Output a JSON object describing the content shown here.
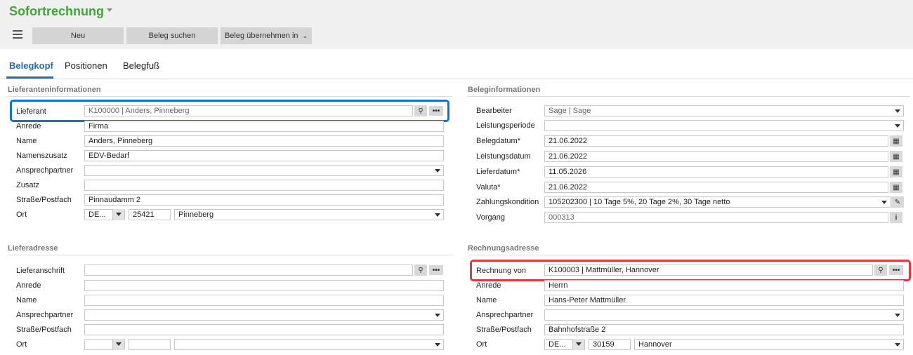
{
  "app": {
    "title": "Sofortrechnung"
  },
  "toolbar": {
    "new_label": "Neu",
    "search_label": "Beleg suchen",
    "adopt_label": "Beleg übernehmen in"
  },
  "tabs": [
    {
      "label": "Belegkopf"
    },
    {
      "label": "Positionen"
    },
    {
      "label": "Belegfuß"
    }
  ],
  "supplier": {
    "title": "Lieferanteninformationen",
    "lieferant_label": "Lieferant",
    "lieferant_value": "K100000  |  Anders, Pinneberg",
    "anrede_label": "Anrede",
    "anrede_value": "Firma",
    "name_label": "Name",
    "name_value": "Anders, Pinneberg",
    "zusatz_name_label": "Namenszusatz",
    "zusatz_name_value": "EDV-Bedarf",
    "ansprech_label": "Ansprechpartner",
    "ansprech_value": "",
    "zusatz_label": "Zusatz",
    "zusatz_value": "",
    "strasse_label": "Straße/Postfach",
    "strasse_value": "Pinnaudamm 2",
    "ort_label": "Ort",
    "country_value": "DE...",
    "plz_value": "25421",
    "city_value": "Pinneberg"
  },
  "doc_info": {
    "title": "Beleginformationen",
    "bearbeiter_label": "Bearbeiter",
    "bearbeiter_value": "Sage  |  Sage",
    "periode_label": "Leistungsperiode",
    "periode_value": "",
    "belegdatum_label": "Belegdatum*",
    "belegdatum_value": "21.06.2022",
    "leistungsdatum_label": "Leistungsdatum",
    "leistungsdatum_value": "21.06.2022",
    "lieferdatum_label": "Lieferdatum*",
    "lieferdatum_value": "11.05.2026",
    "valuta_label": "Valuta*",
    "valuta_value": "21.06.2022",
    "zahlung_label": "Zahlungskondition",
    "zahlung_value": "105202300  |  10 Tage 5%, 20 Tage 2%, 30 Tage netto",
    "vorgang_label": "Vorgang",
    "vorgang_value": "000313"
  },
  "delivery": {
    "title": "Lieferadresse",
    "anschrift_label": "Lieferanschrift",
    "anschrift_value": "",
    "anrede_label": "Anrede",
    "anrede_value": "",
    "name_label": "Name",
    "name_value": "",
    "ansprech_label": "Ansprechpartner",
    "ansprech_value": "",
    "strasse_label": "Straße/Postfach",
    "strasse_value": "",
    "ort_label": "Ort",
    "country_value": "",
    "plz_value": "",
    "city_value": ""
  },
  "invoice": {
    "title": "Rechnungsadresse",
    "von_label": "Rechnung von",
    "von_value": "K100003  |  Mattmüller, Hannover",
    "anrede_label": "Anrede",
    "anrede_value": "Herrn",
    "name_label": "Name",
    "name_value": "Hans-Peter Mattmüller",
    "ansprech_label": "Ansprechpartner",
    "ansprech_value": "",
    "strasse_label": "Straße/Postfach",
    "strasse_value": "Bahnhofstraße 2",
    "ort_label": "Ort",
    "country_value": "DE...",
    "plz_value": "30159",
    "city_value": "Hannover"
  },
  "icons": {
    "search": "magnifier-icon",
    "more": "more-dots-icon",
    "calendar": "calendar-icon",
    "edit": "pencil-icon",
    "info": "info-icon",
    "menu": "hamburger-icon"
  },
  "colors": {
    "title_green": "#3fa535",
    "tab_blue": "#2a6ab3",
    "highlight_blue": "#1175c9",
    "highlight_red": "#e0383c"
  }
}
